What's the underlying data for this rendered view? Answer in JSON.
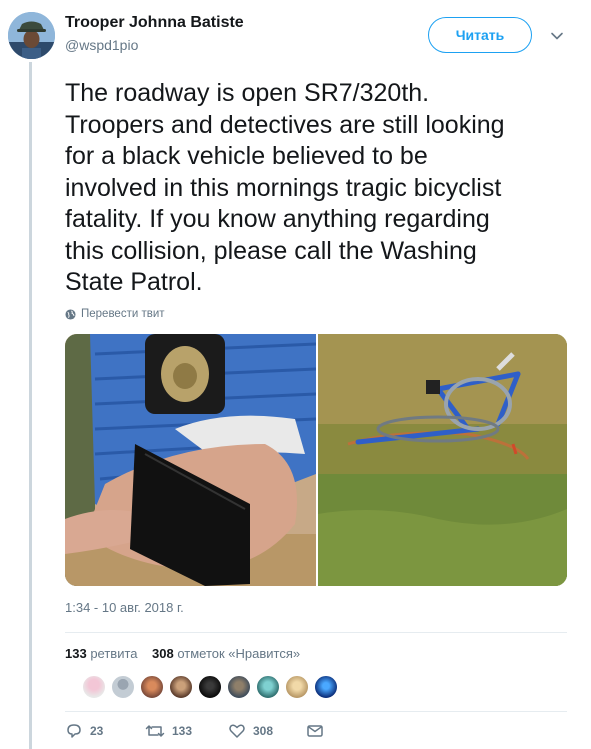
{
  "author": {
    "name": "Trooper Johnna Batiste",
    "handle": "@wspd1pio"
  },
  "follow_label": "Читать",
  "tweet_text": "The roadway is open SR7/320th.\nTroopers and detectives are still looking\nfor a black vehicle believed to be\ninvolved in this mornings tragic bicyclist\nfatality. If you know anything regarding\nthis collision, please call the Washing\nState Patrol.",
  "translate_label": "Перевести твит",
  "timestamp": "1:34 - 10 авг. 2018 г.",
  "stats": {
    "retweets_count": "133",
    "retweets_label": "ретвита",
    "likes_count": "308",
    "likes_label": "отметок «Нравится»"
  },
  "actions": {
    "reply_count": "23",
    "retweet_count": "133",
    "like_count": "308"
  },
  "colors": {
    "accent": "#1da1f2",
    "secondary_text": "#657786",
    "divider": "#e6ecf0"
  },
  "icons": [
    "chevron-down-icon",
    "globe-icon",
    "reply-icon",
    "retweet-icon",
    "heart-icon",
    "mail-icon"
  ]
}
